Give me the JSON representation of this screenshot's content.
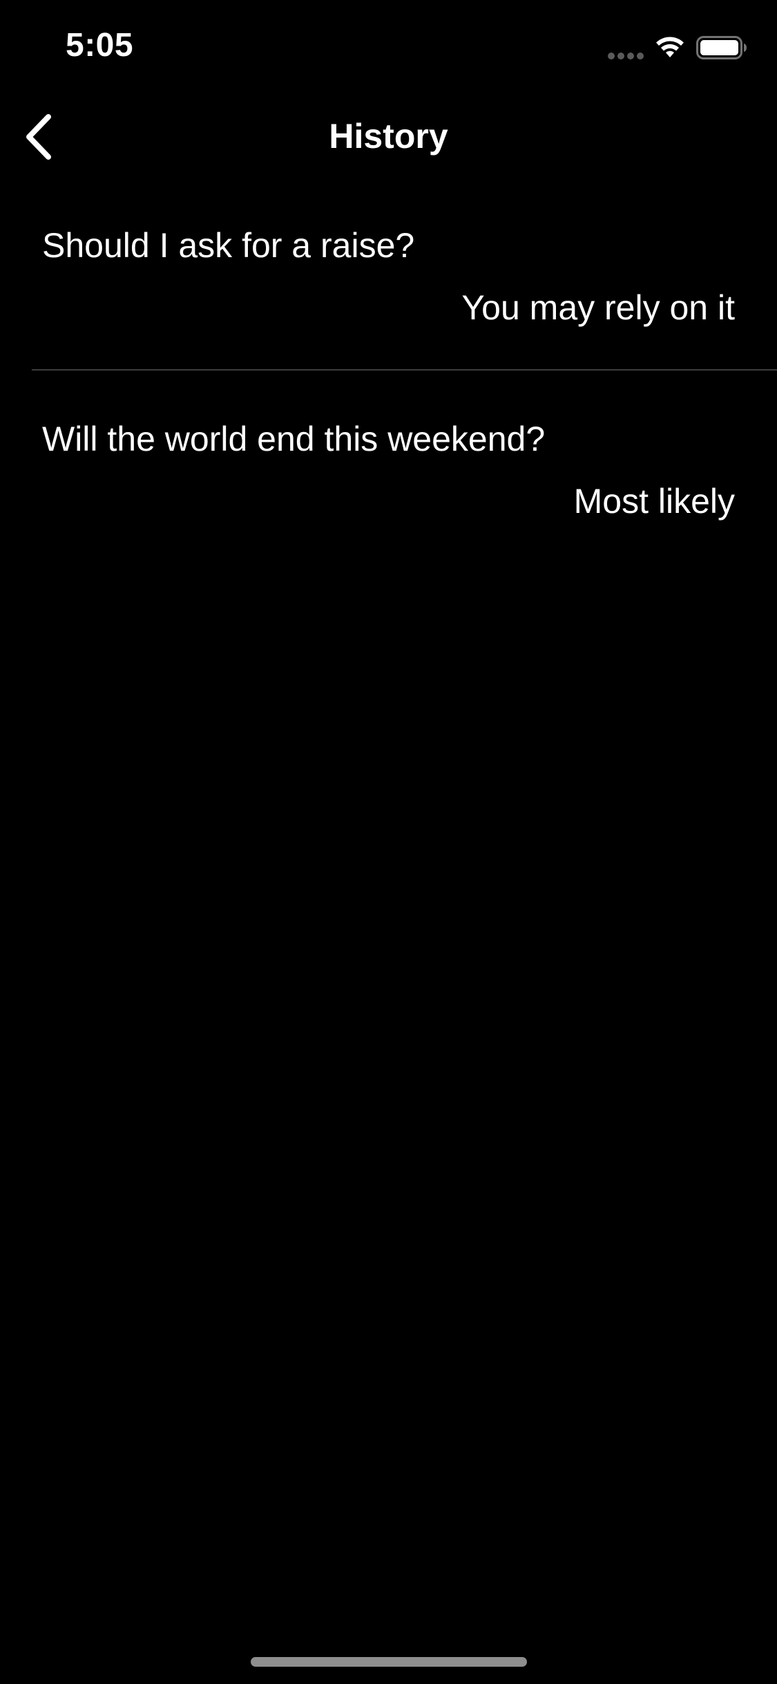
{
  "status_bar": {
    "time": "5:05",
    "signal_icon": "signal-dots-icon",
    "wifi_icon": "wifi-icon",
    "battery_icon": "battery-icon"
  },
  "nav": {
    "title": "History",
    "back_icon": "chevron-left-icon"
  },
  "history": [
    {
      "question": "Should I ask for a raise?",
      "answer": "You may rely on it"
    },
    {
      "question": "Will the world end this weekend?",
      "answer": "Most likely"
    }
  ],
  "colors": {
    "background": "#000000",
    "text": "#ffffff",
    "separator": "#3d3d3f",
    "home_indicator": "#8e8e8e"
  }
}
